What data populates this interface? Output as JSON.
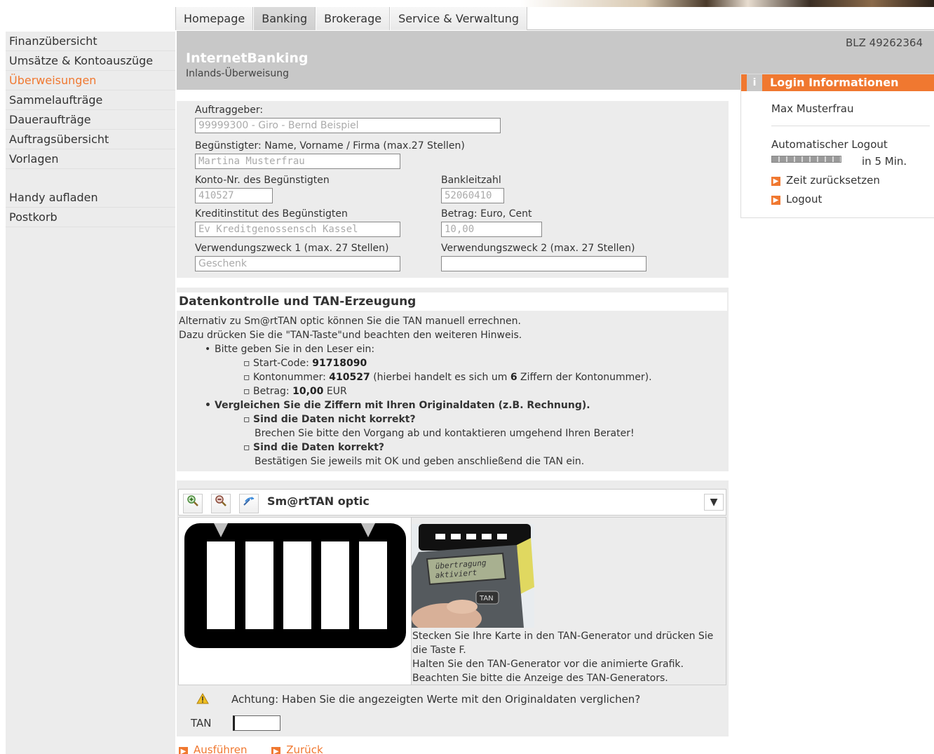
{
  "topnav": {
    "tabs": [
      "Homepage",
      "Banking",
      "Brokerage",
      "Service & Verwaltung"
    ],
    "active": "Banking"
  },
  "sidebar": {
    "items": [
      "Finanzübersicht",
      "Umsätze & Kontoauszüge",
      "Überweisungen",
      "Sammelaufträge",
      "Daueraufträge",
      "Auftragsübersicht",
      "Vorlagen"
    ],
    "items2": [
      "Handy aufladen",
      "Postkorb"
    ],
    "active": "Überweisungen"
  },
  "header": {
    "blz": "BLZ 49262364",
    "title": "InternetBanking",
    "subtitle": "Inlands-Überweisung"
  },
  "login": {
    "title": "Login Informationen",
    "info_icon": "i",
    "user": "Max Musterfrau",
    "auto_logout_label": "Automatischer Logout",
    "remaining": "in 5 Min.",
    "reset_link": "Zeit zurücksetzen",
    "logout_link": "Logout"
  },
  "form": {
    "auftraggeber_label": "Auftraggeber:",
    "auftraggeber_value": "99999300 - Giro - Bernd Beispiel",
    "beguenstigter_label": "Begünstigter: Name, Vorname / Firma (max.27 Stellen)",
    "beguenstigter_value": "Martina Musterfrau",
    "konto_label": "Konto-Nr. des Begünstigten",
    "konto_value": "410527",
    "blz_label": "Bankleitzahl",
    "blz_value": "52060410",
    "institut_label": "Kreditinstitut des Begünstigten",
    "institut_value": "Ev Kreditgenossensch Kassel",
    "betrag_label": "Betrag: Euro, Cent",
    "betrag_value": "10,00",
    "vz1_label": "Verwendungszweck 1 (max. 27 Stellen)",
    "vz1_value": "Geschenk",
    "vz2_label": "Verwendungszweck 2 (max. 27 Stellen)",
    "vz2_value": ""
  },
  "datenkontrolle": {
    "heading": "Datenkontrolle und TAN-Erzeugung",
    "intro1": "Alternativ zu Sm@rtTAN optic können Sie die TAN manuell errechnen.",
    "intro2": "Dazu drücken Sie die \"TAN-Taste\"und beachten den weiteren Hinweis.",
    "bullet1": "Bitte geben Sie in den Leser ein:",
    "startcode_label": "Start-Code: ",
    "startcode_value": "91718090",
    "konto_label": "Kontonummer: ",
    "konto_value": "410527",
    "konto_hint_pre": " (hierbei handelt es sich um ",
    "konto_hint_num": "6",
    "konto_hint_post": " Ziffern der Kontonummer).",
    "betrag_label": "Betrag: ",
    "betrag_value": "10,00",
    "betrag_unit": " EUR",
    "bullet2": "Vergleichen Sie die Ziffern mit Ihren Originaldaten (z.B. Rechnung).",
    "not_correct_q": "Sind die Daten nicht korrekt?",
    "not_correct_a": "Brechen Sie bitte den Vorgang ab und kontaktieren umgehend Ihren Berater!",
    "correct_q": "Sind die Daten korrekt?",
    "correct_a": "Bestätigen Sie jeweils mit OK und geben anschließend die TAN ein."
  },
  "smarttan": {
    "title": "Sm@rtTAN optic",
    "device_text_1": "übertragung",
    "device_text_2": "aktiviert",
    "device_key": "TAN",
    "hint1": "Stecken Sie Ihre Karte in den TAN-Generator und drücken Sie die Taste F.",
    "hint2": "Halten Sie den TAN-Generator vor die animierte Grafik.",
    "hint3": "Beachten Sie bitte die Anzeige des TAN-Generators.",
    "warning": "Achtung: Haben Sie die angezeigten Werte mit den Originaldaten verglichen?",
    "tan_label": "TAN",
    "tan_value": ""
  },
  "actions": {
    "execute": "Ausführen",
    "back": "Zurück"
  },
  "colors": {
    "accent": "#f07830",
    "header_bg": "#c8c8c8",
    "panel_bg": "#ececec"
  }
}
